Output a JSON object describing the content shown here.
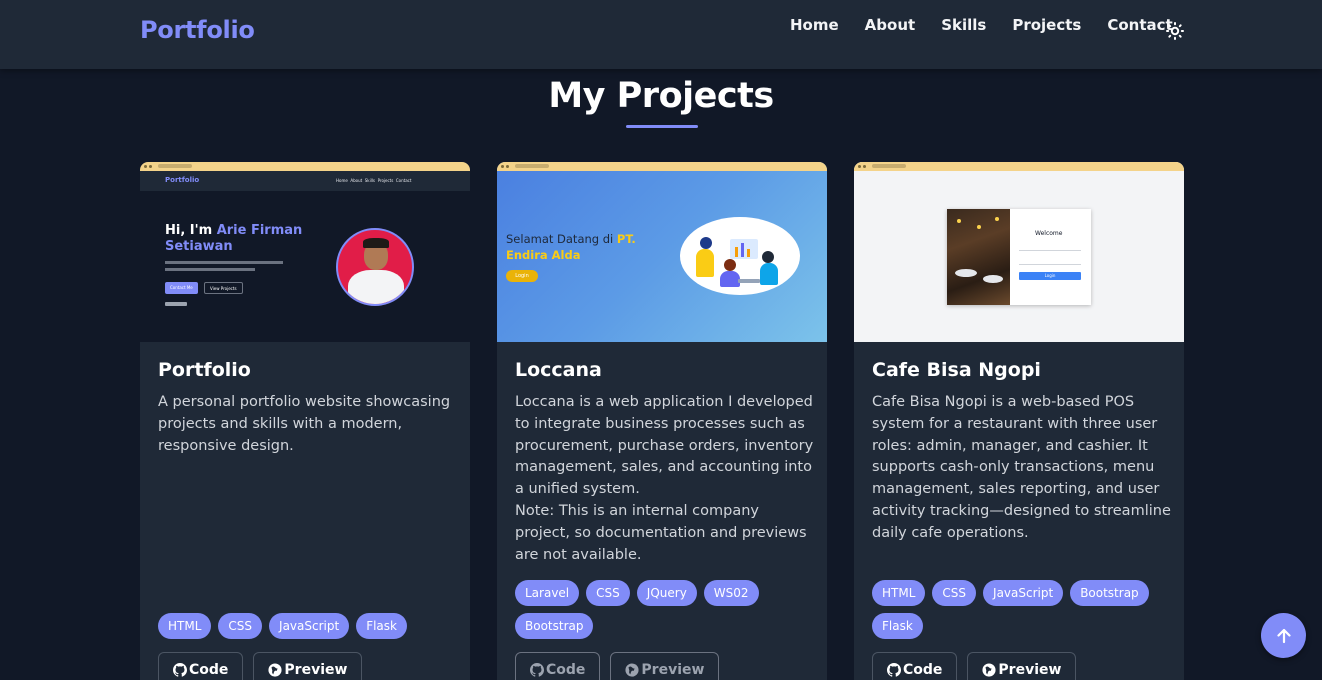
{
  "navbar": {
    "brand": "Portfolio",
    "links": [
      "Home",
      "About",
      "Skills",
      "Projects",
      "Contact"
    ],
    "theme_icon": "sun-icon"
  },
  "section": {
    "title": "My Projects"
  },
  "projects": [
    {
      "title": "Portfolio",
      "description": "A personal portfolio website showcasing projects and skills with a modern, responsive design.",
      "tags": [
        "HTML",
        "CSS",
        "JavaScript",
        "Flask"
      ],
      "code_label": "Code",
      "preview_label": "Preview",
      "thumb": {
        "brand": "Portfolio",
        "nav": [
          "Home",
          "About",
          "Skills",
          "Projects",
          "Contact"
        ],
        "greeting": "Hi, I'm ",
        "name_line1": "Arie Firman",
        "name_line2": "Setiawan",
        "btn1": "Contact Me",
        "btn2": "View Projects"
      }
    },
    {
      "title": "Loccana",
      "description": "Loccana is a web application I developed to integrate business processes such as procurement, purchase orders, inventory management, sales, and accounting into a unified system.\nNote: This is an internal company project, so documentation and previews are not available.",
      "tags": [
        "Laravel",
        "CSS",
        "JQuery",
        "WS02",
        "Bootstrap"
      ],
      "code_label": "Code",
      "preview_label": "Preview",
      "thumb": {
        "welcome": "Selamat Datang di ",
        "company_a": "PT.",
        "company_b": "Endira Alda",
        "button": "Login"
      }
    },
    {
      "title": "Cafe Bisa Ngopi",
      "description": "Cafe Bisa Ngopi is a web-based POS system for a restaurant with three user roles: admin, manager, and cashier. It supports cash-only transactions, menu management, sales reporting, and user activity tracking—designed to streamline daily cafe operations.",
      "tags": [
        "HTML",
        "CSS",
        "JavaScript",
        "Bootstrap",
        "Flask"
      ],
      "code_label": "Code",
      "preview_label": "Preview",
      "thumb": {
        "welcome": "Welcome",
        "button": "Login"
      }
    }
  ],
  "colors": {
    "background": "#111827",
    "card": "#1f2937",
    "accent": "#818cf8",
    "tag_text": "#ffffff"
  },
  "icons": {
    "code": "github-icon",
    "preview": "globe-icon",
    "scroll_top": "arrow-up-icon"
  }
}
